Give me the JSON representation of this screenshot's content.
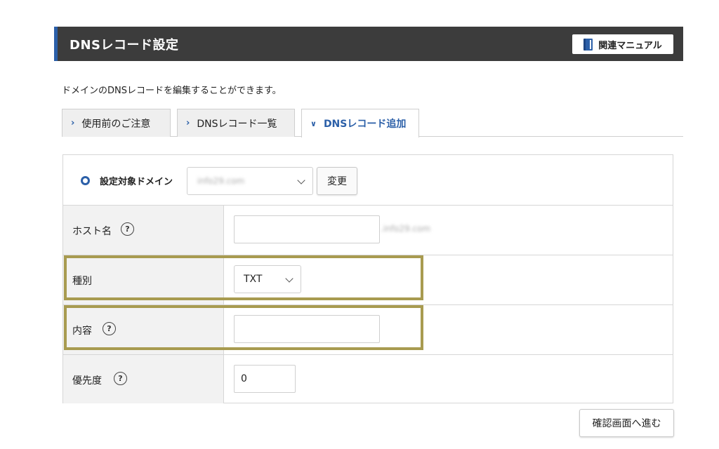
{
  "header": {
    "title": "DNSレコード設定",
    "manual_label": "関連マニュアル",
    "manual_icon": "book-icon",
    "accent_color": "#2b5fa8"
  },
  "description": "ドメインのDNSレコードを編集することができます。",
  "tabs": [
    {
      "label": "使用前のご注意",
      "active": false
    },
    {
      "label": "DNSレコード一覧",
      "active": false
    },
    {
      "label": "DNSレコード追加",
      "active": true
    }
  ],
  "domain": {
    "label": "設定対象ドメイン",
    "selected": "info29.com",
    "change_label": "変更"
  },
  "form": {
    "host": {
      "label": "ホスト名",
      "value": "",
      "suffix": ".info29.com"
    },
    "type": {
      "label": "種別",
      "selected": "TXT"
    },
    "content": {
      "label": "内容",
      "value": ""
    },
    "priority": {
      "label": "優先度",
      "value": "0"
    }
  },
  "help_glyph": "?",
  "confirm_label": "確認画面へ進む",
  "highlight_color": "#a89b50"
}
